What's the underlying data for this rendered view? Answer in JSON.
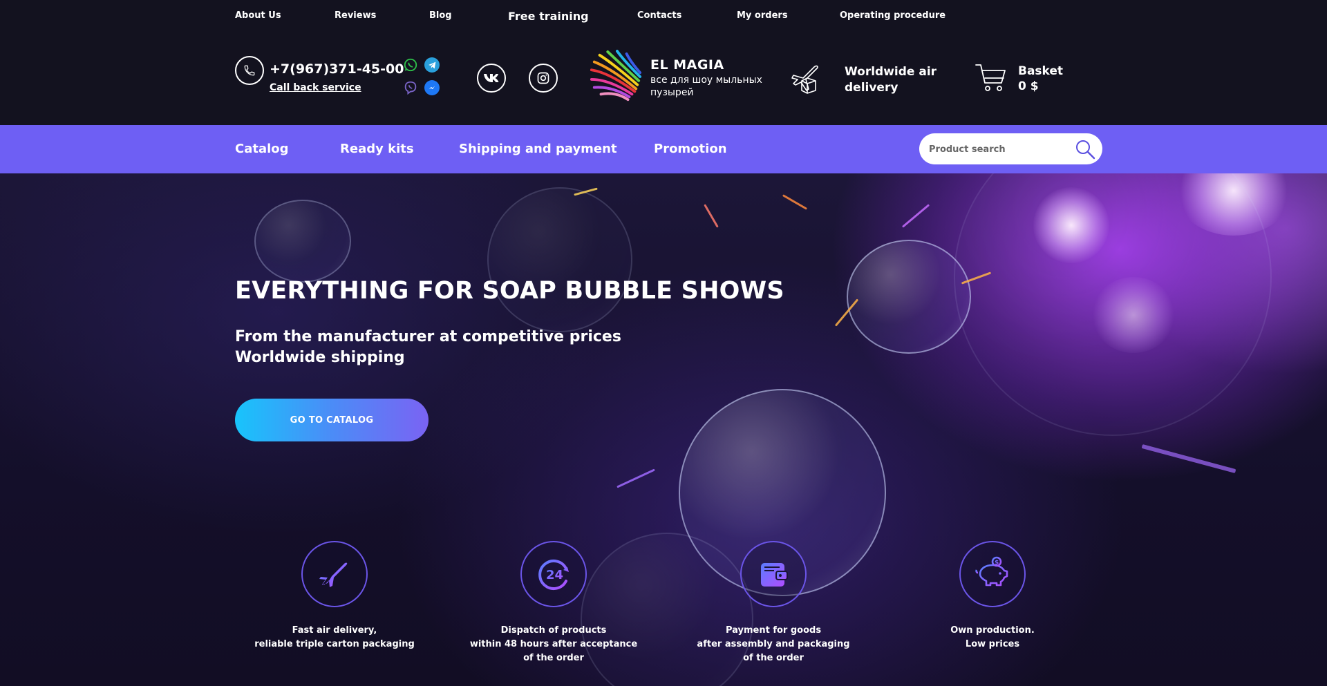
{
  "top_nav": {
    "items": [
      "About Us",
      "Reviews",
      "Blog",
      "Free training",
      "Contacts",
      "My orders",
      "Operating procedure"
    ]
  },
  "header": {
    "phone": "+7(967)371-45-00",
    "callback": "Call back service",
    "logo_name": "EL MAGIA",
    "logo_tagline": "все для шоу мыльных пузырей",
    "delivery": "Worldwide air delivery",
    "basket_label": "Basket",
    "basket_total": "0 $",
    "icons": [
      "phone-icon",
      "whatsapp-icon",
      "telegram-icon",
      "viber-icon",
      "messenger-icon",
      "vk-icon",
      "instagram-icon",
      "airplane-box-icon",
      "cart-icon"
    ]
  },
  "menu": {
    "items": [
      "Catalog",
      "Ready kits",
      "Shipping and payment",
      "Promotion"
    ],
    "search_placeholder": "Product search"
  },
  "hero": {
    "title": "EVERYTHING FOR SOAP BUBBLE SHOWS",
    "subtitle_line1": "From the manufacturer at competitive prices",
    "subtitle_line2": "Worldwide shipping",
    "cta": "GO TO CATALOG"
  },
  "features": [
    {
      "icon": "plane-icon",
      "line1": "Fast air delivery,",
      "line2": "reliable triple carton packaging",
      "line3": ""
    },
    {
      "icon": "24-hours-icon",
      "line1": "Dispatch of products",
      "line2": "within 48 hours after acceptance",
      "line3": "of the order"
    },
    {
      "icon": "wallet-icon",
      "line1": "Payment for goods",
      "line2": "after assembly and packaging",
      "line3": "of the order"
    },
    {
      "icon": "piggy-bank-icon",
      "line1": "Own production.",
      "line2": "Low prices",
      "line3": ""
    }
  ],
  "colors": {
    "header_bg": "#13121f",
    "menu_bg": "#6e5ff4",
    "cta_start": "#18c4fb",
    "cta_end": "#7a63f3",
    "feature_ring": "#6b55e8"
  }
}
